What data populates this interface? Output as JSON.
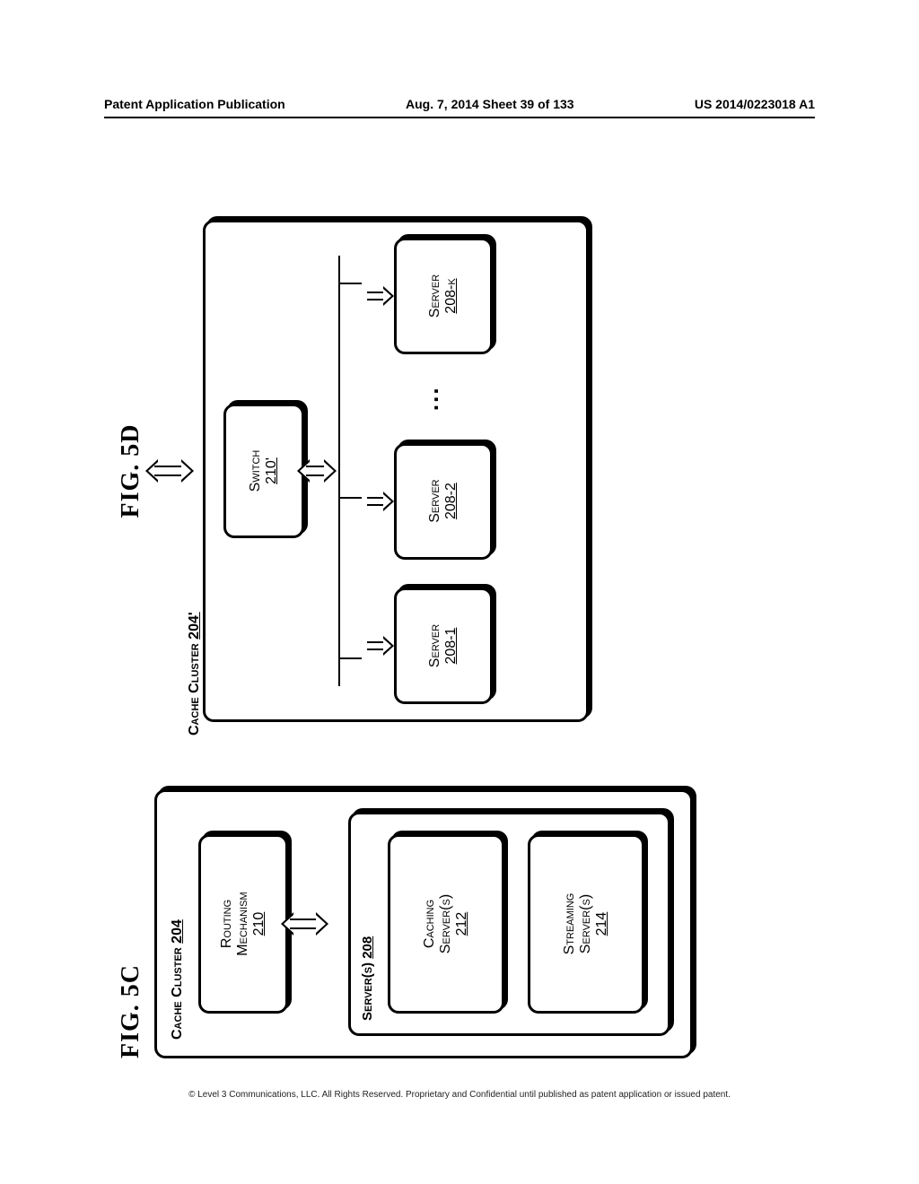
{
  "header": {
    "left": "Patent Application Publication",
    "center": "Aug. 7, 2014  Sheet 39 of 133",
    "right": "US 2014/0223018 A1"
  },
  "fig5c": {
    "title": "FIG. 5C",
    "cluster_label": "Cache Cluster",
    "cluster_ref": "204",
    "routing": {
      "line1": "Routing",
      "line2": "Mechanism",
      "ref": "210"
    },
    "servers_group": {
      "label": "Server(s)",
      "ref": "208"
    },
    "caching": {
      "line1": "Caching",
      "line2": "Server(s)",
      "ref": "212"
    },
    "streaming": {
      "line1": "Streaming",
      "line2": "Server(s)",
      "ref": "214"
    }
  },
  "fig5d": {
    "title": "FIG. 5D",
    "cluster_label": "Cache Cluster",
    "cluster_ref": "204'",
    "switch": {
      "label": "Switch",
      "ref": "210'"
    },
    "servers": [
      {
        "label": "Server",
        "ref": "208-1"
      },
      {
        "label": "Server",
        "ref": "208-2"
      },
      {
        "label": "Server",
        "ref": "208-k"
      }
    ],
    "ellipsis": "..."
  },
  "footer": "© Level 3 Communications, LLC.  All Rights Reserved.  Proprietary and Confidential until published as patent application or issued patent."
}
